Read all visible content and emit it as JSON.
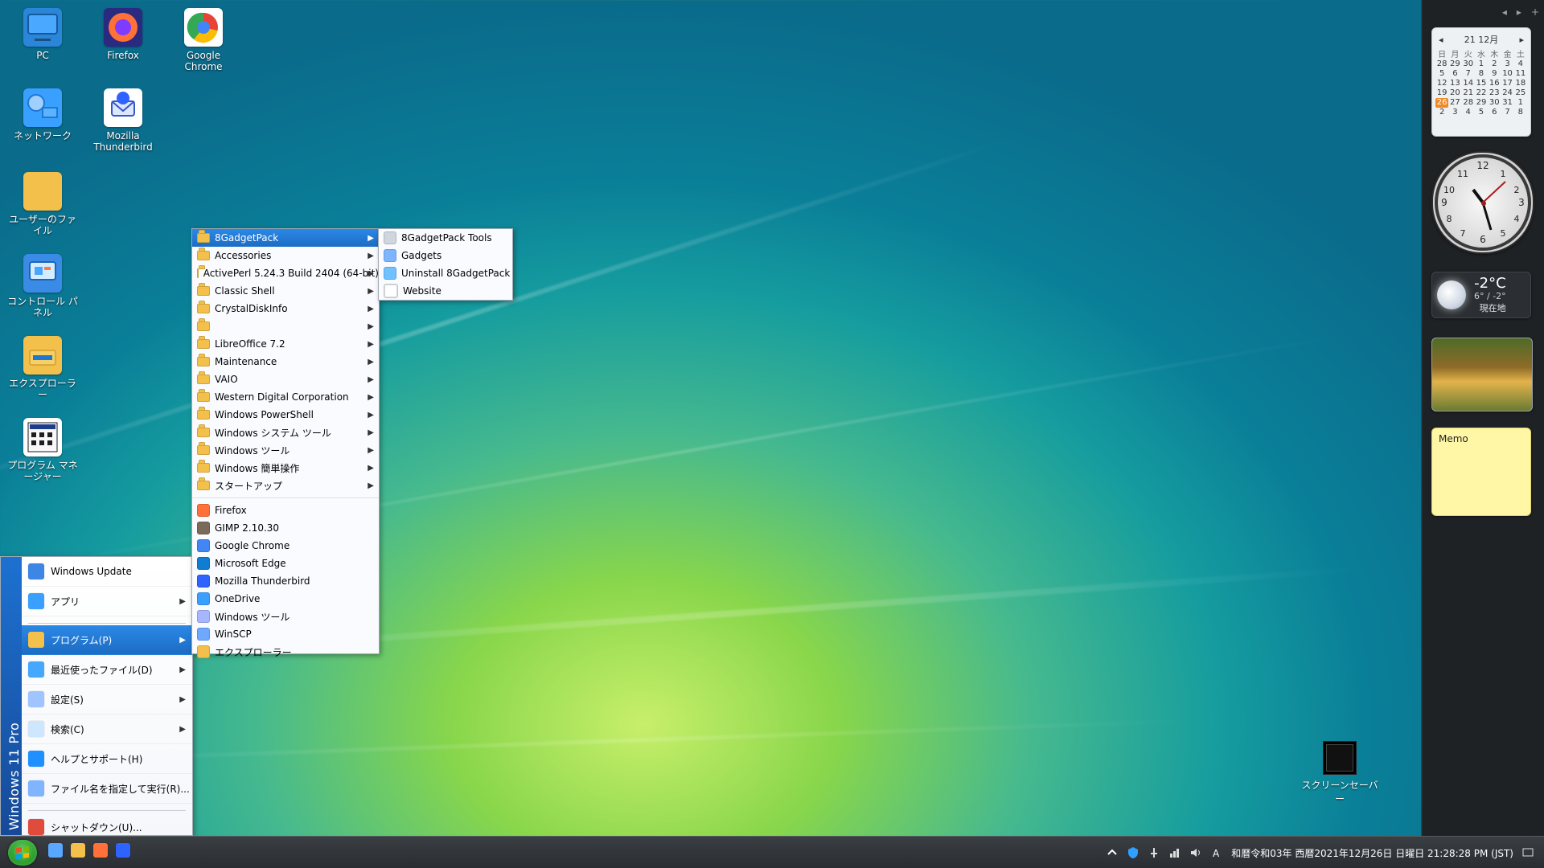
{
  "desktop": {
    "icons": [
      {
        "label": "PC",
        "icon": "pc-icon"
      },
      {
        "label": "Firefox",
        "icon": "firefox-icon"
      },
      {
        "label": "Google Chrome",
        "icon": "chrome-icon"
      },
      {
        "label": "ネットワーク",
        "icon": "network-icon"
      },
      {
        "label": "Mozilla Thunderbird",
        "icon": "thunderbird-icon"
      },
      {
        "label": "ユーザーのファイル",
        "icon": "user-files-icon"
      },
      {
        "label": "コントロール パネル",
        "icon": "control-panel-icon"
      },
      {
        "label": "エクスプローラー",
        "icon": "explorer-icon"
      },
      {
        "label": "プログラム マネージャー",
        "icon": "program-manager-icon"
      }
    ],
    "screensaver": {
      "label": "スクリーンセーバー",
      "icon": "screensaver-icon"
    }
  },
  "start_menu": {
    "brand": "Windows 11 Pro",
    "items": [
      {
        "label": "Windows Update",
        "icon": "windows-update-icon",
        "has_submenu": false
      },
      {
        "label": "アプリ",
        "icon": "apps-icon",
        "has_submenu": true
      },
      {
        "label": "プログラム(P)",
        "icon": "programs-icon",
        "has_submenu": true,
        "selected": true
      },
      {
        "label": "最近使ったファイル(D)",
        "icon": "recent-files-icon",
        "has_submenu": true
      },
      {
        "label": "設定(S)",
        "icon": "settings-icon",
        "has_submenu": true
      },
      {
        "label": "検索(C)",
        "icon": "search-icon",
        "has_submenu": true
      },
      {
        "label": "ヘルプとサポート(H)",
        "icon": "help-icon",
        "has_submenu": false
      },
      {
        "label": "ファイル名を指定して実行(R)...",
        "icon": "run-icon",
        "has_submenu": false
      },
      {
        "label": "シャットダウン(U)...",
        "icon": "shutdown-icon",
        "has_submenu": false
      }
    ]
  },
  "programs_menu": {
    "items": [
      {
        "label": "8GadgetPack",
        "type": "folder",
        "has_submenu": true,
        "selected": true
      },
      {
        "label": "Accessories",
        "type": "folder",
        "has_submenu": true
      },
      {
        "label": "ActivePerl 5.24.3 Build 2404 (64-bit)",
        "type": "folder",
        "has_submenu": true
      },
      {
        "label": "Classic Shell",
        "type": "folder",
        "has_submenu": true
      },
      {
        "label": "CrystalDiskInfo",
        "type": "folder",
        "has_submenu": true
      },
      {
        "label": "",
        "type": "folder",
        "has_submenu": true
      },
      {
        "label": "LibreOffice 7.2",
        "type": "folder",
        "has_submenu": true
      },
      {
        "label": "Maintenance",
        "type": "folder",
        "has_submenu": true
      },
      {
        "label": "VAIO",
        "type": "folder",
        "has_submenu": true
      },
      {
        "label": "Western Digital Corporation",
        "type": "folder",
        "has_submenu": true
      },
      {
        "label": "Windows PowerShell",
        "type": "folder",
        "has_submenu": true
      },
      {
        "label": "Windows システム ツール",
        "type": "folder",
        "has_submenu": true
      },
      {
        "label": "Windows ツール",
        "type": "folder",
        "has_submenu": true
      },
      {
        "label": "Windows 簡単操作",
        "type": "folder",
        "has_submenu": true
      },
      {
        "label": "スタートアップ",
        "type": "folder",
        "has_submenu": true
      },
      {
        "label": "Firefox",
        "type": "app",
        "icon": "firefox-icon"
      },
      {
        "label": "GIMP 2.10.30",
        "type": "app",
        "icon": "gimp-icon"
      },
      {
        "label": "Google Chrome",
        "type": "app",
        "icon": "chrome-icon"
      },
      {
        "label": "Microsoft Edge",
        "type": "app",
        "icon": "edge-icon"
      },
      {
        "label": "Mozilla Thunderbird",
        "type": "app",
        "icon": "thunderbird-icon"
      },
      {
        "label": "OneDrive",
        "type": "app",
        "icon": "onedrive-icon"
      },
      {
        "label": "Windows ツール",
        "type": "app",
        "icon": "windows-tools-icon"
      },
      {
        "label": "WinSCP",
        "type": "app",
        "icon": "winscp-icon"
      },
      {
        "label": "エクスプローラー",
        "type": "app",
        "icon": "explorer-icon"
      }
    ]
  },
  "gadgetpack_submenu": {
    "items": [
      {
        "label": "8GadgetPack Tools",
        "icon": "tools-icon"
      },
      {
        "label": "Gadgets",
        "icon": "gadgets-icon"
      },
      {
        "label": "Uninstall 8GadgetPack",
        "icon": "uninstall-icon"
      },
      {
        "label": "Website",
        "icon": "website-icon"
      }
    ]
  },
  "sidebar": {
    "controls": [
      "◂",
      "▸",
      "+"
    ],
    "calendar": {
      "month_label": "21 12月",
      "weekdays": [
        "日",
        "月",
        "火",
        "水",
        "木",
        "金",
        "土"
      ],
      "weeks": [
        [
          "28",
          "29",
          "30",
          "1",
          "2",
          "3",
          "4"
        ],
        [
          "5",
          "6",
          "7",
          "8",
          "9",
          "10",
          "11"
        ],
        [
          "12",
          "13",
          "14",
          "15",
          "16",
          "17",
          "18"
        ],
        [
          "19",
          "20",
          "21",
          "22",
          "23",
          "24",
          "25"
        ],
        [
          "26",
          "27",
          "28",
          "29",
          "30",
          "31",
          "1"
        ],
        [
          "2",
          "3",
          "4",
          "5",
          "6",
          "7",
          "8"
        ]
      ],
      "today": "26"
    },
    "clock": {
      "numerals": [
        "12",
        "1",
        "2",
        "3",
        "4",
        "5",
        "6",
        "7",
        "8",
        "9",
        "10",
        "11"
      ]
    },
    "weather": {
      "temp": "-2°C",
      "range": "6° / -2°",
      "location": "現在地"
    },
    "memo": {
      "title": "Memo"
    }
  },
  "taskbar": {
    "quick_launch": [
      {
        "icon": "show-desktop-icon"
      },
      {
        "icon": "explorer-icon"
      },
      {
        "icon": "firefox-icon"
      },
      {
        "icon": "thunderbird-icon"
      }
    ],
    "tray": {
      "icons": [
        "chevron-up-icon",
        "defender-icon",
        "usb-icon",
        "network-icon",
        "volume-icon",
        "ime-icon"
      ],
      "clock_text": "和暦令和03年 西暦2021年12月26日 日曜日 21:28:28 PM (JST)"
    }
  },
  "colors": {
    "accent": "#1c6cc3",
    "folder": "#f3c04b"
  }
}
